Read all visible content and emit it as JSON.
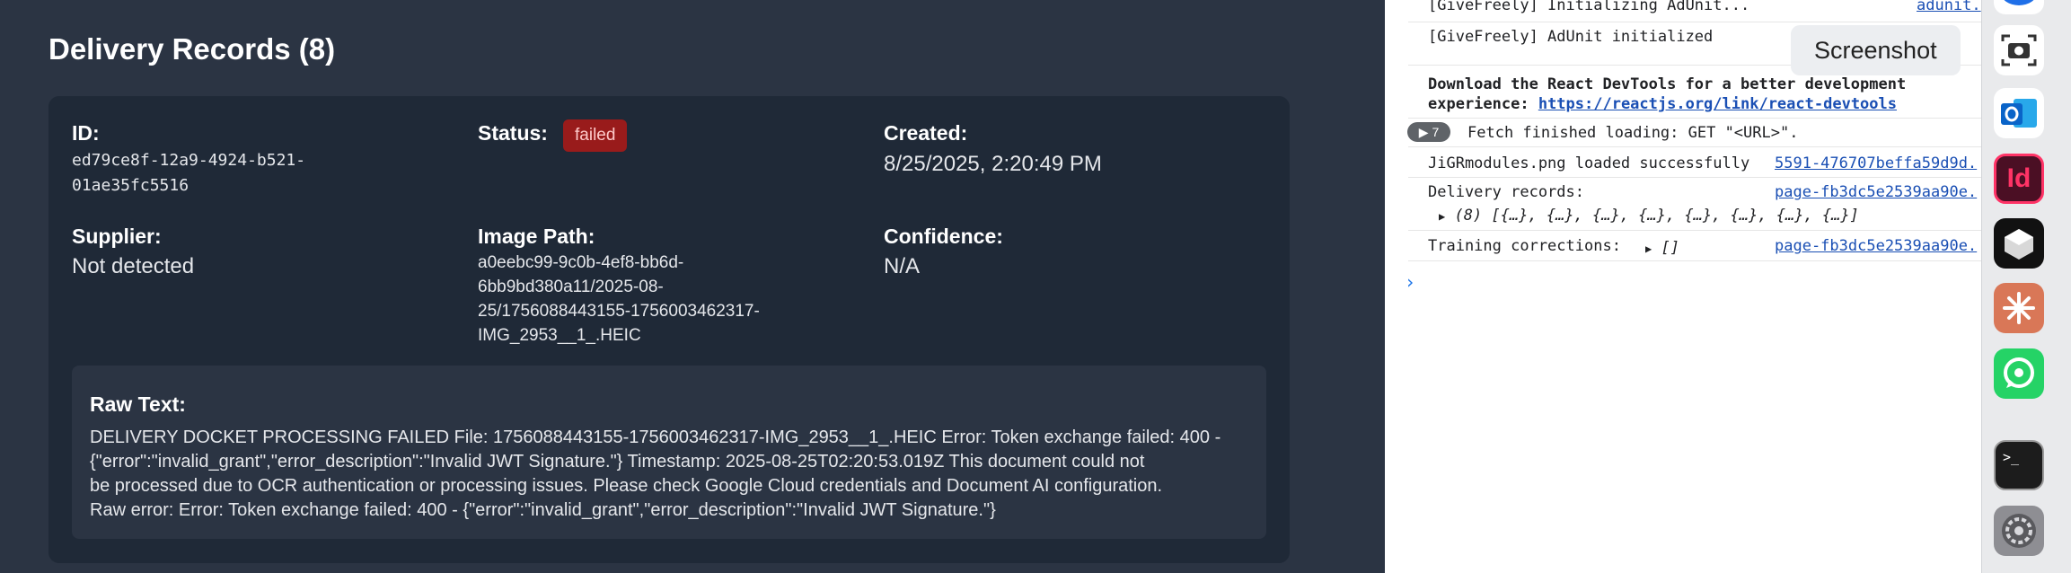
{
  "app": {
    "title": "Delivery Records (8)",
    "record": {
      "id_label": "ID:",
      "id_value_line1": "ed79ce8f-12a9-4924-b521-",
      "id_value_line2": "01ae35fc5516",
      "status_label": "Status:",
      "status_badge": "failed",
      "status_color": "#991b1b",
      "created_label": "Created:",
      "created_value": "8/25/2025, 2:20:49 PM",
      "supplier_label": "Supplier:",
      "supplier_value": "Not detected",
      "image_path_label": "Image Path:",
      "image_path_lines": [
        "a0eebc99-9c0b-4ef8-bb6d-",
        "6bb9bd380a11/2025-08-",
        "25/1756088443155-1756003462317-",
        "IMG_2953__1_.HEIC"
      ],
      "confidence_label": "Confidence:",
      "confidence_value": "N/A",
      "raw_text_label": "Raw Text:",
      "raw_text_lines": [
        "DELIVERY DOCKET PROCESSING FAILED File: 1756088443155-1756003462317-IMG_2953__1_.HEIC Error: Token exchange failed: 400 -",
        "{\"error\":\"invalid_grant\",\"error_description\":\"Invalid JWT Signature.\"} Timestamp: 2025-08-25T02:20:53.019Z This document could not",
        "be processed due to OCR authentication or processing issues. Please check Google Cloud credentials and Document AI configuration.",
        "Raw error: Error: Token exchange failed: 400 - {\"error\":\"invalid_grant\",\"error_description\":\"Invalid JWT Signature.\"}"
      ]
    }
  },
  "console": {
    "line_initializing": "[GiveFreely] Initializing AdUnit...",
    "line_initializing_src": "adunit.",
    "line_initialized": "[GiveFreely] AdUnit initialized",
    "devtools_text_line1": "Download the React DevTools for a better development",
    "devtools_text_line2_prefix": "experience: ",
    "devtools_link": "https://reactjs.org/link/react-devtools",
    "repeat_count": "7",
    "fetch_line": "Fetch finished loading: GET \"<URL>\".",
    "png_line": "JiGRmodules.png loaded successfully",
    "png_src": "5591-476707beffa59d9d.",
    "records_label": "Delivery records:",
    "records_src": "page-fb3dc5e2539aa90e.",
    "records_value": "(8) [{…}, {…}, {…}, {…}, {…}, {…}, {…}, {…}]",
    "training_label": "Training corrections:",
    "training_value": "[]",
    "training_src": "page-fb3dc5e2539aa90e."
  },
  "tooltip": {
    "text": "Screenshot"
  },
  "dock": {
    "icons": [
      "messages-icon",
      "screenshot-icon",
      "outlook-icon",
      "indesign-icon",
      "perplexity-icon",
      "claude-icon",
      "whatsapp-icon",
      "terminal-icon",
      "system-settings-icon"
    ],
    "indesign_label": "Id",
    "terminal_label": ">_"
  }
}
